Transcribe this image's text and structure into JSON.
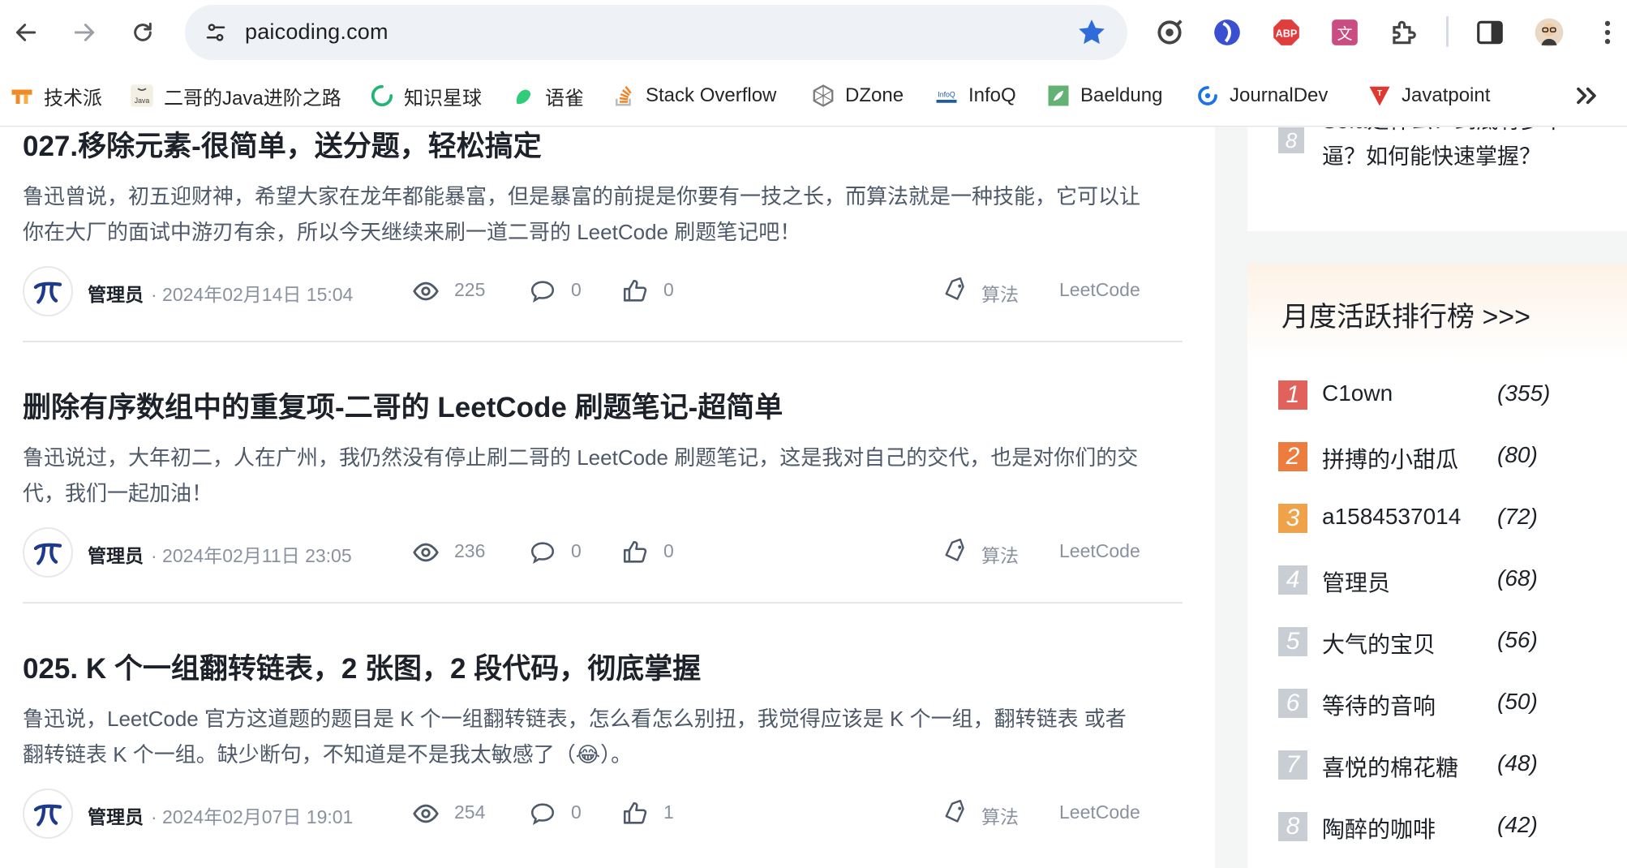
{
  "browser": {
    "url": "paicoding.com",
    "bookmarks": [
      {
        "label": "技术派",
        "icon": "paicoding-icon"
      },
      {
        "label": "二哥的Java进阶之路",
        "icon": "java-icon"
      },
      {
        "label": "知识星球",
        "icon": "zsxq-icon"
      },
      {
        "label": "语雀",
        "icon": "yuque-icon"
      },
      {
        "label": "Stack Overflow",
        "icon": "stackoverflow-icon"
      },
      {
        "label": "DZone",
        "icon": "dzone-icon"
      },
      {
        "label": "InfoQ",
        "icon": "infoq-icon"
      },
      {
        "label": "Baeldung",
        "icon": "baeldung-icon"
      },
      {
        "label": "JournalDev",
        "icon": "journaldev-icon"
      },
      {
        "label": "Javatpoint",
        "icon": "javatpoint-icon"
      }
    ]
  },
  "articles": [
    {
      "title": "027.移除元素-很简单，送分题，轻松搞定",
      "summary": "鲁迅曾说，初五迎财神，希望大家在龙年都能暴富，但是暴富的前提是你要有一技之长，而算法就是一种技能，它可以让你在大厂的面试中游刃有余，所以今天继续来刷一道二哥的 LeetCode 刷题笔记吧！",
      "author": "管理员",
      "date": "· 2024年02月14日 15:04",
      "views": "225",
      "comments": "0",
      "likes": "0",
      "tag1": "算法",
      "tag2": "LeetCode"
    },
    {
      "title": "删除有序数组中的重复项-二哥的 LeetCode 刷题笔记-超简单",
      "summary": "鲁迅说过，大年初二，人在广州，我仍然没有停止刷二哥的 LeetCode 刷题笔记，这是我对自己的交代，也是对你们的交代，我们一起加油！",
      "author": "管理员",
      "date": "· 2024年02月11日 23:05",
      "views": "236",
      "comments": "0",
      "likes": "0",
      "tag1": "算法",
      "tag2": "LeetCode"
    },
    {
      "title": "025. K 个一组翻转链表，2 张图，2 段代码，彻底掌握",
      "summary": "鲁迅说，LeetCode 官方这道题的题目是 K 个一组翻转链表，怎么看怎么别扭，我觉得应该是 K 个一组，翻转链表 或者 翻转链表 K 个一组。缺少断句，不知道是不是我太敏感了（😂）。",
      "author": "管理员",
      "date": "· 2024年02月07日 19:01",
      "views": "254",
      "comments": "0",
      "likes": "1",
      "tag1": "算法",
      "tag2": "LeetCode"
    }
  ],
  "sidebar": {
    "partial_item": {
      "rank": "8",
      "text_line1": "Sofa是什么？到底有多牛",
      "text_line2": "逼？如何能快速掌握？"
    },
    "ranking": {
      "title": "月度活跃排行榜 >>>",
      "items": [
        {
          "rank": "1",
          "name": "C1own",
          "score": "(355)",
          "color": "#e0625a"
        },
        {
          "rank": "2",
          "name": "拼搏的小甜瓜",
          "score": "(80)",
          "color": "#ec7d3f"
        },
        {
          "rank": "3",
          "name": "a1584537014",
          "score": "(72)",
          "color": "#f0a24a"
        },
        {
          "rank": "4",
          "name": "管理员",
          "score": "(68)",
          "color": "#c9cdd4"
        },
        {
          "rank": "5",
          "name": "大气的宝贝",
          "score": "(56)",
          "color": "#c9cdd4"
        },
        {
          "rank": "6",
          "name": "等待的音响",
          "score": "(50)",
          "color": "#c9cdd4"
        },
        {
          "rank": "7",
          "name": "喜悦的棉花糖",
          "score": "(48)",
          "color": "#c9cdd4"
        },
        {
          "rank": "8",
          "name": "陶醉的咖啡",
          "score": "(42)",
          "color": "#c9cdd4"
        }
      ]
    }
  }
}
